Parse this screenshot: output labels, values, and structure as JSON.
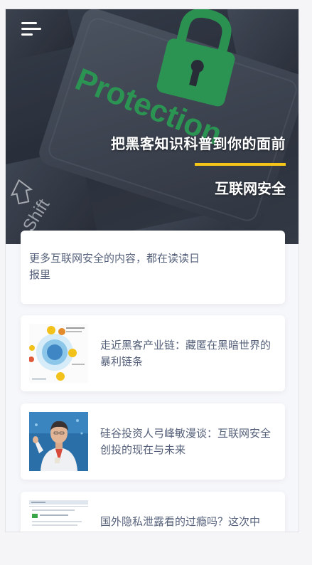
{
  "hero": {
    "title": "把黑客知识科普到你的面前",
    "subtitle": "互联网安全",
    "accent_color": "#f5c518",
    "background_words": [
      "Protection",
      "Shift"
    ],
    "menu_icon": "menu-icon"
  },
  "intro": {
    "text": "更多互联网安全的内容，都在读读日报里"
  },
  "articles": [
    {
      "title": "走近黑客产业链：藏匿在黑暗世界的暴利链条",
      "thumb": "diagram-thumbnail"
    },
    {
      "title": "硅谷投资人弓峰敏漫谈：互联网安全创投的现在与未来",
      "thumb": "speaker-photo-thumbnail"
    },
    {
      "title": "国外隐私泄露看的过瘾吗？这次中",
      "thumb": "webpage-screenshot-thumbnail"
    }
  ]
}
